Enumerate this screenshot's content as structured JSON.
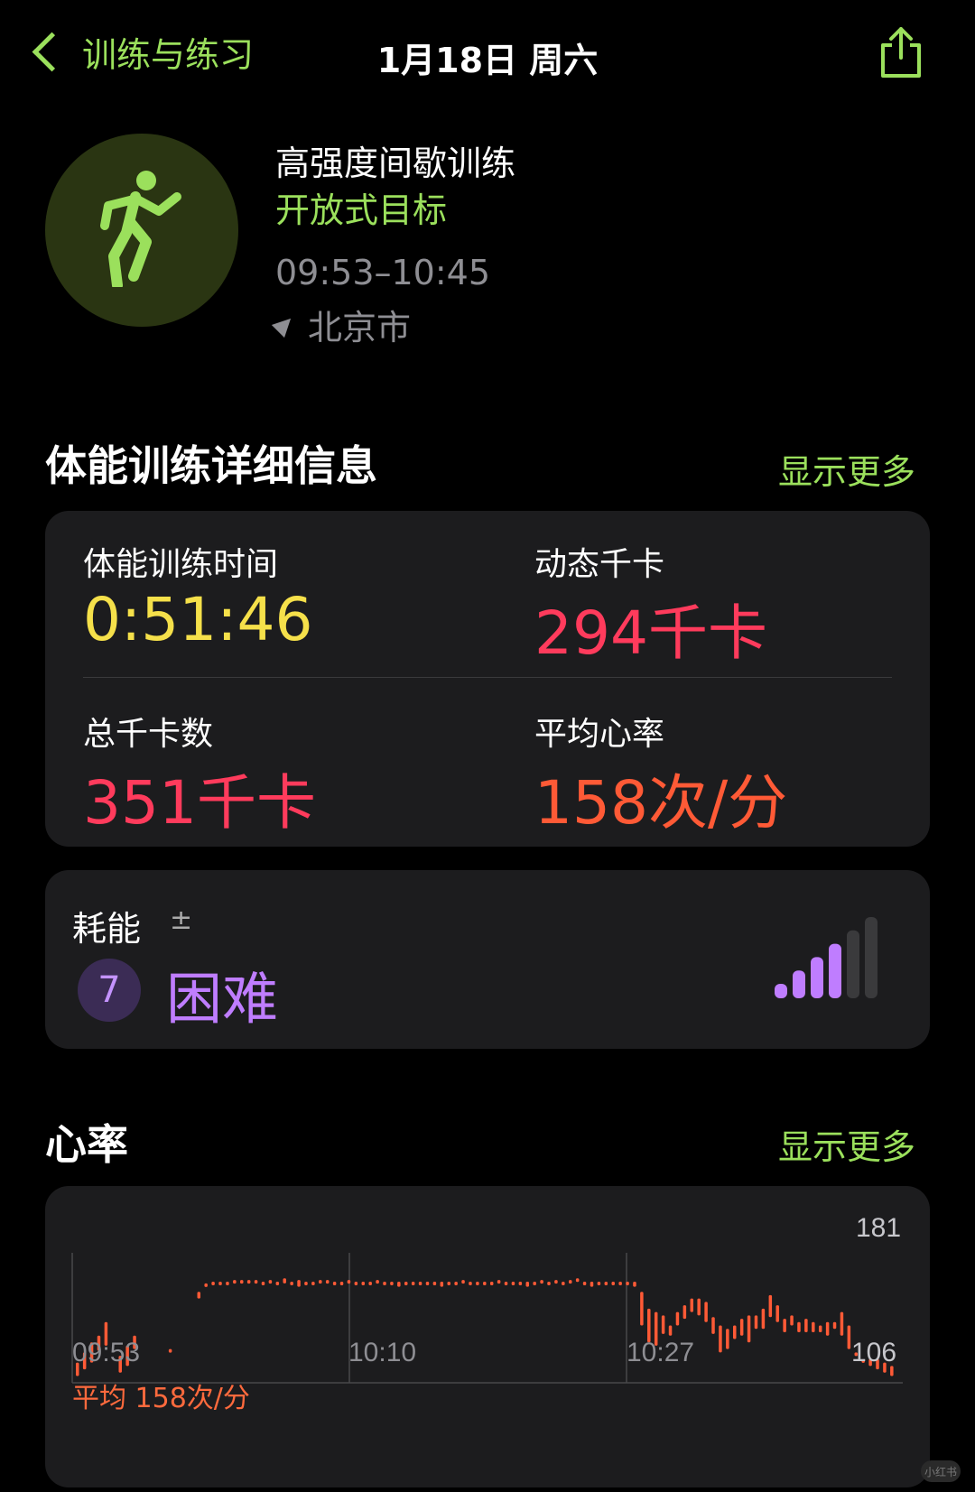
{
  "nav": {
    "back_label": "训练与练习",
    "title": "1月18日 周六"
  },
  "workout": {
    "name": "高强度间歇训练",
    "goal": "开放式目标",
    "time_range": "09:53–10:45",
    "location": "北京市"
  },
  "details": {
    "title": "体能训练详细信息",
    "show_more": "显示更多",
    "metrics": [
      {
        "label": "体能训练时间",
        "value": "0:51:46",
        "color": "#f5e04a"
      },
      {
        "label": "动态千卡",
        "value": "294千卡",
        "color": "#ff3b5c"
      },
      {
        "label": "总千卡数",
        "value": "351千卡",
        "color": "#ff3b5c"
      },
      {
        "label": "平均心率",
        "value": "158次/分",
        "color": "#ff5a36"
      }
    ]
  },
  "effort": {
    "label": "耗能",
    "plus_minus": "±",
    "level": "7",
    "level_text": "困难",
    "bars_filled": 4,
    "bars_total": 6,
    "color": "#bf7dff"
  },
  "heart_rate": {
    "title": "心率",
    "show_more": "显示更多",
    "average": "平均 158次/分"
  },
  "chart_data": {
    "type": "bar",
    "ylim": [
      106,
      181
    ],
    "y_labels": {
      "max": "181",
      "min": "106"
    },
    "x_labels": [
      "09:53",
      "10:10",
      "10:27"
    ],
    "color": "#ff5a36",
    "series": [
      {
        "values": [
          [
            110,
            118
          ],
          [
            114,
            124
          ],
          [
            118,
            130
          ],
          [
            125,
            134
          ],
          [
            128,
            142
          ],
          null,
          [
            112,
            122
          ],
          [
            116,
            128
          ],
          [
            126,
            134
          ],
          null,
          null,
          null,
          null,
          [
            124,
            126
          ],
          null,
          null,
          null,
          [
            156,
            160
          ],
          [
            163,
            165
          ],
          [
            164,
            166
          ],
          [
            164,
            166
          ],
          [
            164,
            166
          ],
          [
            165,
            167
          ],
          [
            165,
            167
          ],
          [
            165,
            167
          ],
          [
            165,
            167
          ],
          [
            164,
            166
          ],
          [
            165,
            167
          ],
          [
            164,
            166
          ],
          [
            165,
            168
          ],
          [
            164,
            166
          ],
          [
            163,
            167
          ],
          [
            164,
            166
          ],
          [
            164,
            166
          ],
          [
            165,
            167
          ],
          [
            165,
            167
          ],
          [
            164,
            166
          ],
          [
            164,
            166
          ],
          [
            165,
            167
          ],
          [
            164,
            166
          ],
          [
            164,
            166
          ],
          [
            164,
            166
          ],
          [
            165,
            167
          ],
          [
            164,
            166
          ],
          [
            164,
            166
          ],
          [
            163,
            166
          ],
          [
            164,
            166
          ],
          [
            164,
            166
          ],
          [
            164,
            166
          ],
          [
            164,
            166
          ],
          [
            164,
            166
          ],
          [
            163,
            166
          ],
          [
            164,
            166
          ],
          [
            164,
            166
          ],
          [
            165,
            167
          ],
          [
            164,
            166
          ],
          [
            164,
            166
          ],
          [
            164,
            166
          ],
          [
            164,
            166
          ],
          [
            165,
            167
          ],
          [
            164,
            166
          ],
          [
            164,
            166
          ],
          [
            164,
            166
          ],
          [
            163,
            166
          ],
          [
            164,
            166
          ],
          [
            165,
            167
          ],
          [
            164,
            166
          ],
          [
            165,
            167
          ],
          [
            164,
            166
          ],
          [
            165,
            167
          ],
          [
            166,
            168
          ],
          [
            164,
            166
          ],
          [
            163,
            166
          ],
          [
            164,
            166
          ],
          [
            164,
            166
          ],
          [
            164,
            166
          ],
          [
            164,
            166
          ],
          [
            164,
            166
          ],
          [
            163,
            166
          ],
          [
            140,
            160
          ],
          [
            130,
            150
          ],
          [
            128,
            148
          ],
          [
            135,
            146
          ],
          [
            134,
            140
          ],
          [
            140,
            148
          ],
          [
            144,
            152
          ],
          [
            148,
            156
          ],
          [
            146,
            156
          ],
          [
            142,
            154
          ],
          [
            135,
            145
          ],
          [
            124,
            140
          ],
          [
            126,
            138
          ],
          [
            132,
            140
          ],
          [
            134,
            144
          ],
          [
            130,
            146
          ],
          [
            138,
            146
          ],
          [
            138,
            150
          ],
          [
            145,
            158
          ],
          [
            142,
            152
          ],
          [
            136,
            144
          ],
          [
            140,
            146
          ],
          [
            136,
            142
          ],
          [
            136,
            144
          ],
          [
            136,
            142
          ],
          [
            136,
            140
          ],
          [
            134,
            142
          ],
          [
            138,
            142
          ],
          [
            134,
            148
          ],
          [
            126,
            140
          ],
          [
            122,
            124
          ],
          [
            118,
            120
          ],
          [
            116,
            120
          ],
          [
            114,
            120
          ],
          [
            112,
            118
          ],
          [
            110,
            116
          ]
        ]
      }
    ]
  }
}
